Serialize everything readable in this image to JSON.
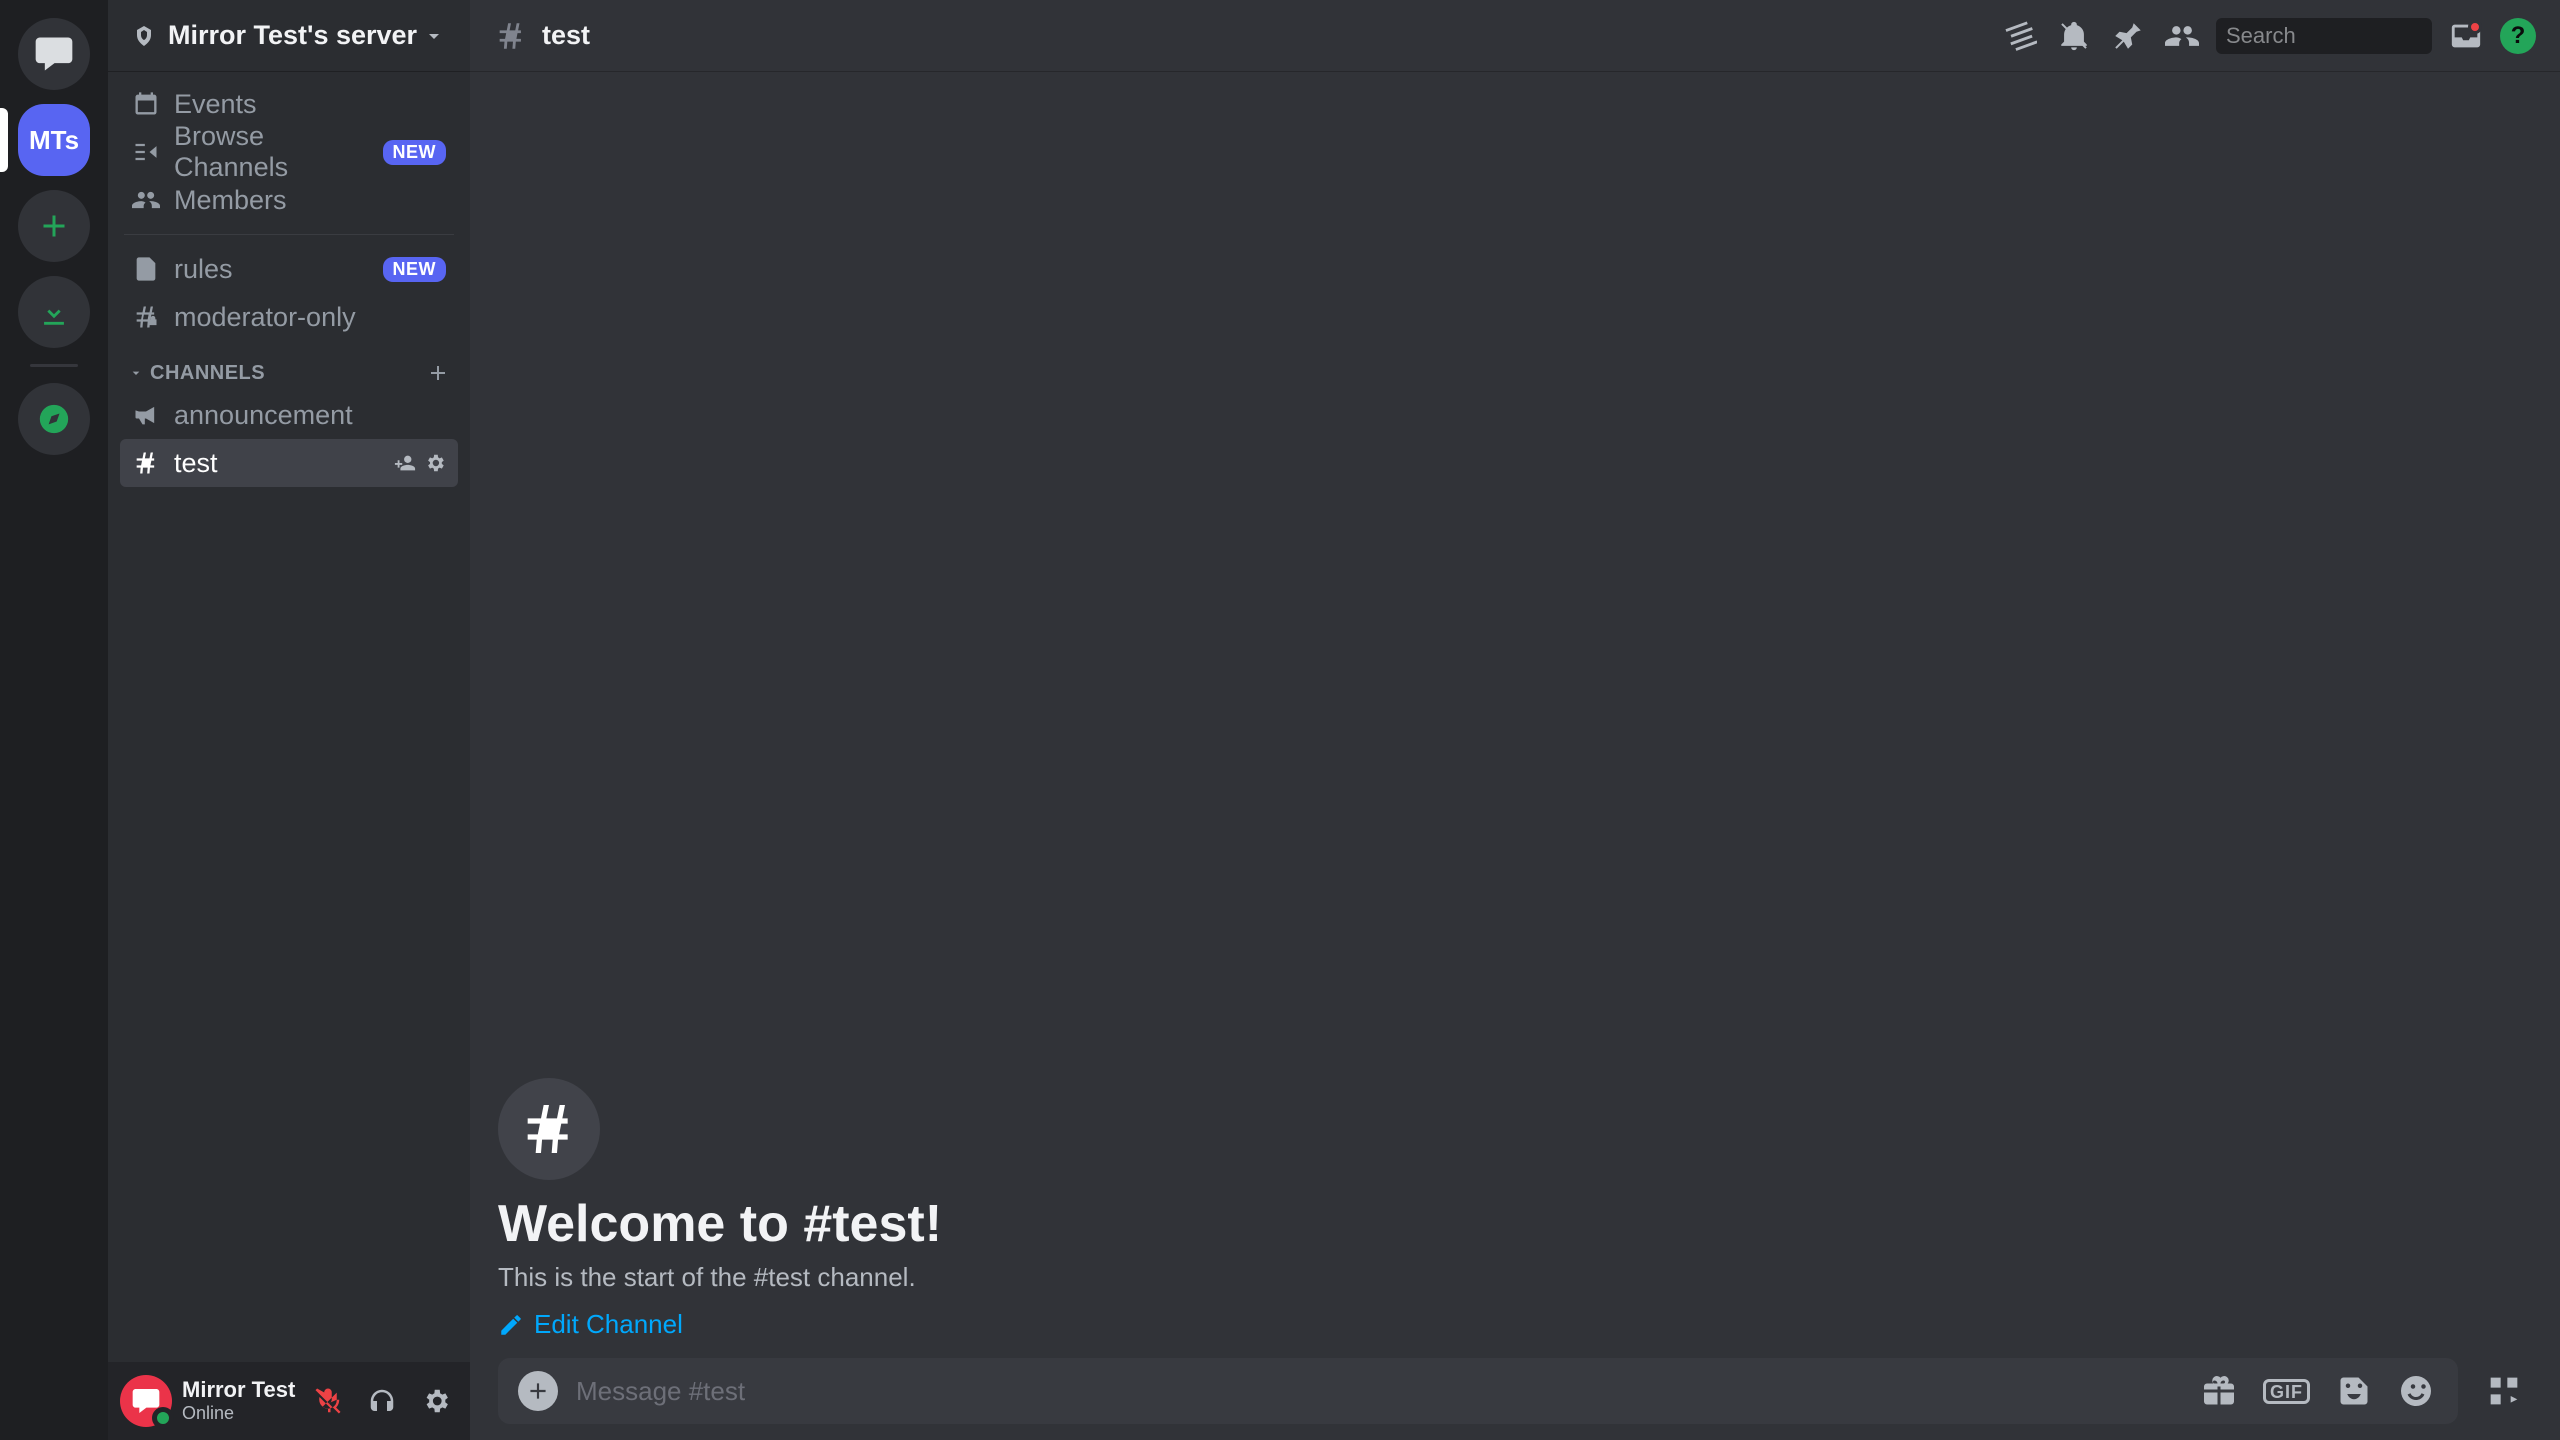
{
  "server_rail": {
    "server_initials": "MTs"
  },
  "sidebar": {
    "server_name": "Mirror Test's server",
    "top_items": [
      {
        "icon": "calendar",
        "label": "Events"
      },
      {
        "icon": "browse",
        "label": "Browse Channels",
        "badge": "NEW"
      },
      {
        "icon": "members",
        "label": "Members"
      }
    ],
    "pinned_channels": [
      {
        "icon": "rules",
        "label": "rules",
        "badge": "NEW"
      },
      {
        "icon": "hash-lock",
        "label": "moderator-only"
      }
    ],
    "category_label": "CHANNELS",
    "channels": [
      {
        "icon": "megaphone",
        "label": "announcement"
      },
      {
        "icon": "hash",
        "label": "test",
        "selected": true
      }
    ]
  },
  "user": {
    "name": "Mirror Test",
    "status": "Online"
  },
  "header": {
    "channel_name": "test",
    "search_placeholder": "Search"
  },
  "welcome": {
    "title": "Welcome to #test!",
    "subtitle": "This is the start of the #test channel.",
    "edit_label": "Edit Channel"
  },
  "composer": {
    "placeholder": "Message #test"
  },
  "colors": {
    "blurple": "#5865f2",
    "green": "#23a559",
    "red": "#ed4245",
    "link": "#00a8fc"
  }
}
